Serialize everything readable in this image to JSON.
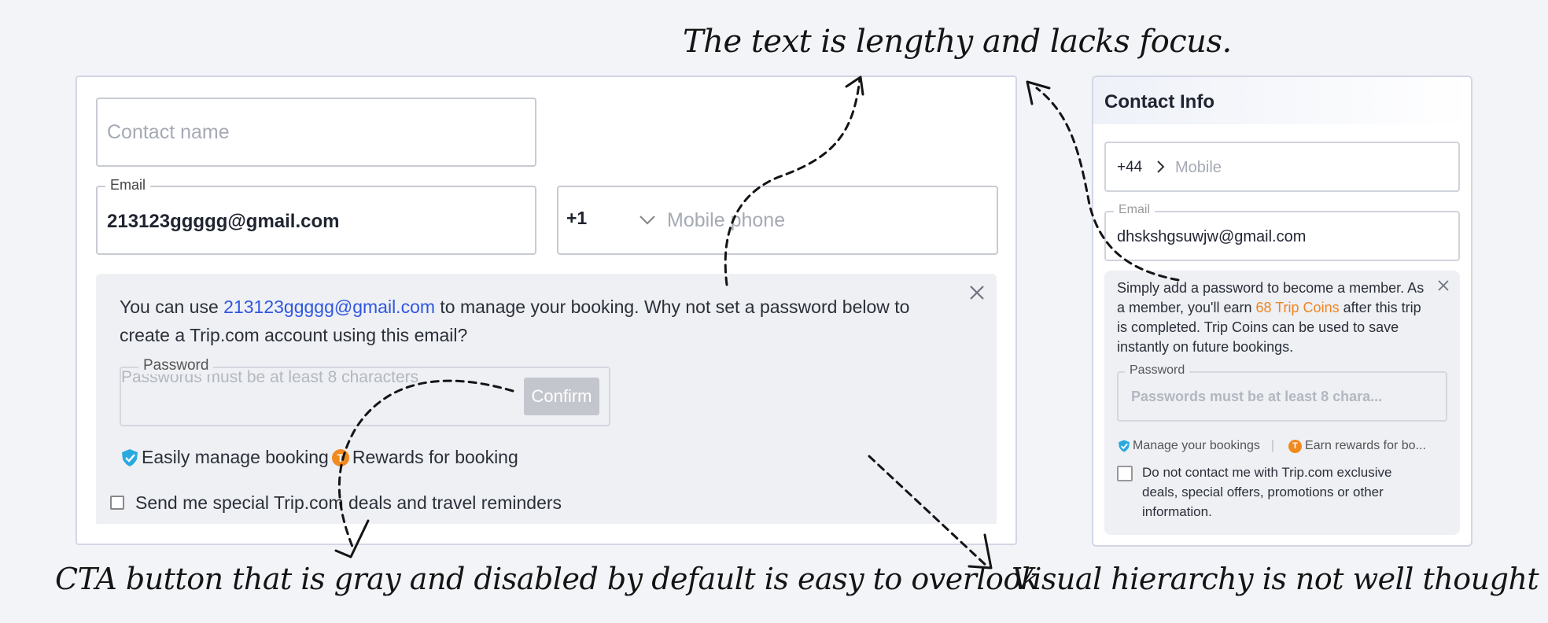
{
  "annotations": {
    "top": "The text is lengthy and lacks focus.",
    "bottom_left": "CTA button that is gray and disabled by default is easy to overlook",
    "bottom_right": "Visual hierarchy is not well thought out"
  },
  "left_form": {
    "contact_name": {
      "placeholder": "Contact name"
    },
    "email": {
      "label": "Email",
      "value": "213123ggggg@gmail.com"
    },
    "phone": {
      "country_code": "+1",
      "placeholder": "Mobile phone"
    },
    "info": {
      "text_before": "You can use ",
      "email_link": "213123ggggg@gmail.com",
      "text_after": " to manage your booking. Why not set a password below to create a Trip.com account using this email?",
      "password_label": "Password",
      "password_placeholder": "Passwords must be at least 8 characters",
      "confirm_label": "Confirm",
      "perk_manage": "Easily manage booking",
      "perk_rewards": "Rewards for booking"
    },
    "newsletter_label": "Send me special Trip.com deals and travel reminders"
  },
  "right_form": {
    "title": "Contact Info",
    "phone": {
      "country_code": "+44",
      "placeholder": "Mobile"
    },
    "email": {
      "label": "Email",
      "value": "dhskshgsuwjw@gmail.com"
    },
    "info": {
      "text_before": "Simply add a password to become a member. As a member, you'll earn ",
      "coins": "68 Trip Coins",
      "text_after": " after this trip is completed. Trip Coins can be used to save instantly on future bookings.",
      "password_label": "Password",
      "password_placeholder": "Passwords must be at least 8 chara...",
      "perk_manage": "Manage your bookings",
      "separator": "|",
      "perk_rewards": "Earn rewards for bo..."
    },
    "opt_out_label": "Do not contact me with Trip.com exclusive deals, special offers, promotions or other information."
  },
  "colors": {
    "link": "#2f56e0",
    "coins": "#f0841e",
    "disabled_button": "#c3c6cc"
  },
  "icons": [
    "close-icon",
    "chevron-down-icon",
    "chevron-right-icon",
    "shield-check-icon",
    "trip-coin-icon",
    "checkbox-icon"
  ]
}
